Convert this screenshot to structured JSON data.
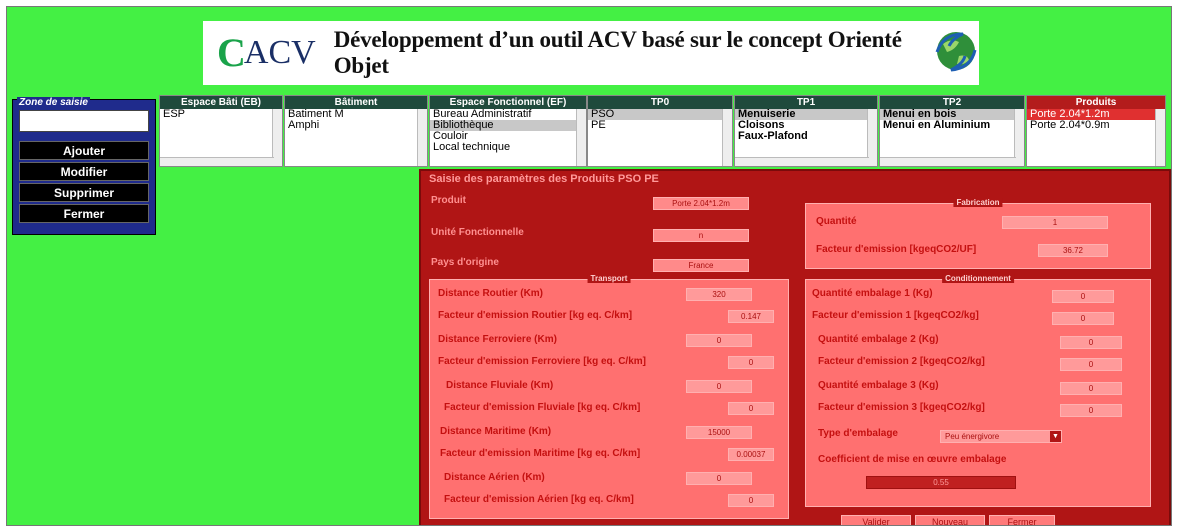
{
  "header": {
    "logo_c": "C",
    "logo_text": "ACV",
    "title": "Développement d’un outil ACV basé sur le concept Orienté Objet"
  },
  "zone": {
    "title": "Zone de saisie",
    "input_value": "",
    "buttons": [
      "Ajouter",
      "Modifier",
      "Supprimer",
      "Fermer"
    ]
  },
  "selectors": [
    {
      "title": "Espace Bâti (EB)",
      "items": [
        "ESP"
      ],
      "selected": -1
    },
    {
      "title": "Bâtiment",
      "items": [
        "Batiment M",
        "Amphi"
      ],
      "selected": -1
    },
    {
      "title": "Espace Fonctionnel (EF)",
      "items": [
        "Bureau Administratif",
        "Bibliothèque",
        "Couloir",
        "Local technique"
      ],
      "selected": 1
    },
    {
      "title": "TP0",
      "items": [
        "PSO",
        "PE"
      ],
      "selected": 0
    },
    {
      "title": "TP1",
      "items": [
        "Menuiserie",
        "Cloisons",
        "Faux-Plafond"
      ],
      "selected": 0
    },
    {
      "title": "TP2",
      "items": [
        "Menui en bois",
        "Menui en Aluminium"
      ],
      "selected": 0
    },
    {
      "title": "Produits",
      "items": [
        "Porte 2.04*1.2m",
        "Porte 2.04*0.9m"
      ],
      "selected": 0
    }
  ],
  "form": {
    "title": "Saisie des paramètres des Produits PSO PE",
    "produit_label": "Produit",
    "produit_value": "Porte 2.04*1.2m",
    "uf_label": "Unité Fonctionnelle",
    "uf_value": "n",
    "pays_label": "Pays d'origine",
    "pays_value": "France",
    "fabrication": {
      "title": "Fabrication",
      "quantite_label": "Quantité",
      "quantite_value": "1",
      "facteur_label": "Facteur d'emission  [kgeqCO2/UF]",
      "facteur_value": "36.72"
    },
    "transport": {
      "title": "Transport",
      "rows": [
        {
          "label": "Distance Routier (Km)",
          "value": "320"
        },
        {
          "label": "Facteur d'emission Routier [kg eq. C/km]",
          "value": "0.147"
        },
        {
          "label": "Distance Ferroviere (Km)",
          "value": "0"
        },
        {
          "label": "Facteur d'emission Ferroviere [kg eq. C/km]",
          "value": "0"
        },
        {
          "label": "Distance Fluviale (Km)",
          "value": "0"
        },
        {
          "label": "Facteur d'emission Fluviale [kg eq. C/km]",
          "value": "0"
        },
        {
          "label": "Distance Maritime (Km)",
          "value": "15000"
        },
        {
          "label": "Facteur d'emission Maritime [kg eq. C/km]",
          "value": "0.00037"
        },
        {
          "label": "Distance Aérien (Km)",
          "value": "0"
        },
        {
          "label": "Facteur d'emission Aérien [kg eq. C/km]",
          "value": "0"
        }
      ]
    },
    "conditionnement": {
      "title": "Conditionnement",
      "rows": [
        {
          "label": "Quantité embalage 1 (Kg)",
          "value": "0"
        },
        {
          "label": "Facteur d'emission 1 [kgeqCO2/kg]",
          "value": "0"
        },
        {
          "label": "Quantité embalage 2 (Kg)",
          "value": "0"
        },
        {
          "label": "Facteur d'emission 2  [kgeqCO2/kg]",
          "value": "0"
        },
        {
          "label": "Quantité embalage 3 (Kg)",
          "value": "0"
        },
        {
          "label": "Facteur d'emission 3 [kgeqCO2/kg]",
          "value": "0"
        }
      ],
      "type_label": "Type d'embalage",
      "type_value": "Peu énergivore",
      "coef_label": "Coefficient de mise en œuvre embalage",
      "coef_value": "0.55"
    },
    "buttons": [
      "Valider",
      "Nouveau",
      "Fermer"
    ]
  }
}
